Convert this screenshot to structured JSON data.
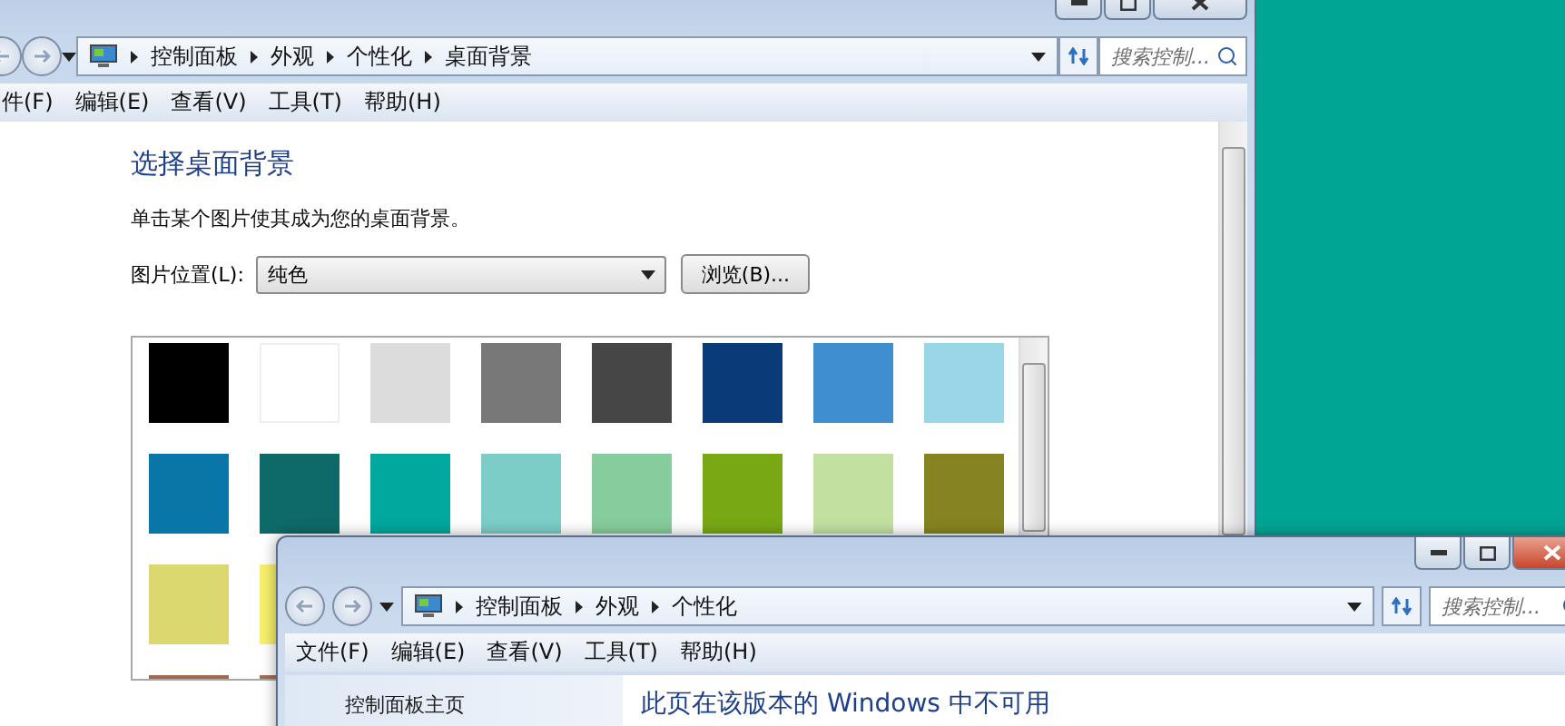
{
  "windows": [
    {
      "active": false,
      "breadcrumb": [
        "控制面板",
        "外观",
        "个性化",
        "桌面背景"
      ],
      "search": {
        "placeholder": "搜索控制..."
      },
      "menu": [
        "件(F)",
        "编辑(E)",
        "查看(V)",
        "工具(T)",
        "帮助(H)"
      ],
      "content": {
        "heading": "选择桌面背景",
        "instruction": "单击某个图片使其成为您的桌面背景。",
        "location": {
          "label": "图片位置(L):",
          "value": "纯色"
        },
        "browse_button": "浏览(B)...",
        "swatch_rows": [
          [
            {
              "color": "#000000"
            },
            {
              "color": "#ffffff"
            },
            {
              "color": "#dcdcdc"
            },
            {
              "color": "#787878"
            },
            {
              "color": "#464646"
            },
            {
              "color": "#0b3a78"
            },
            {
              "color": "#3f8fd0"
            },
            {
              "color": "#98d6e8"
            }
          ],
          [
            {
              "color": "#0a76a8"
            },
            {
              "color": "#0e6a68"
            },
            {
              "color": "#00a89e"
            },
            {
              "color": "#7ccdc8"
            },
            {
              "color": "#86cc9c"
            },
            {
              "color": "#78a814"
            },
            {
              "color": "#c2e0a0"
            },
            {
              "color": "#868420"
            }
          ],
          [
            {
              "color": "#dcd870"
            },
            {
              "color": "#f8f06c"
            }
          ],
          [
            {
              "color": "#a06850"
            },
            {
              "color": "#a07050"
            }
          ]
        ]
      }
    },
    {
      "active": true,
      "breadcrumb": [
        "控制面板",
        "外观",
        "个性化"
      ],
      "search": {
        "placeholder": "搜索控制..."
      },
      "menu": [
        "文件(F)",
        "编辑(E)",
        "查看(V)",
        "工具(T)",
        "帮助(H)"
      ],
      "sidebar": {
        "items": [
          "控制面板主页"
        ]
      },
      "message": "此页在该版本的 Windows 中不可用"
    }
  ]
}
